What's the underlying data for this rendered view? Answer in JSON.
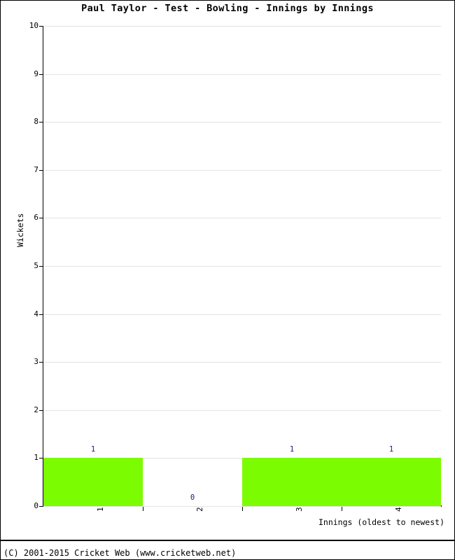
{
  "chart_data": {
    "type": "bar",
    "title": "Paul Taylor - Test - Bowling - Innings by Innings",
    "categories": [
      "1",
      "2",
      "3",
      "4"
    ],
    "values": [
      1,
      0,
      1,
      1
    ],
    "data_labels": [
      "1",
      "0",
      "1",
      "1"
    ],
    "xlabel": "Innings (oldest to newest)",
    "ylabel": "Wickets",
    "ylim": [
      0,
      10
    ],
    "yticks": [
      0,
      1,
      2,
      3,
      4,
      5,
      6,
      7,
      8,
      9,
      10
    ],
    "ytick_labels": [
      "0",
      "1",
      "2",
      "3",
      "4",
      "5",
      "6",
      "7",
      "8",
      "9",
      "10"
    ],
    "grid": true,
    "legend": false,
    "bar_color": "#7cfc00",
    "data_label_color": "#1a1a6e",
    "gridline_color": "#e3e3e3",
    "axis_color": "#000000"
  },
  "footer": {
    "copyright": "(C) 2001-2015 Cricket Web (www.cricketweb.net)"
  }
}
